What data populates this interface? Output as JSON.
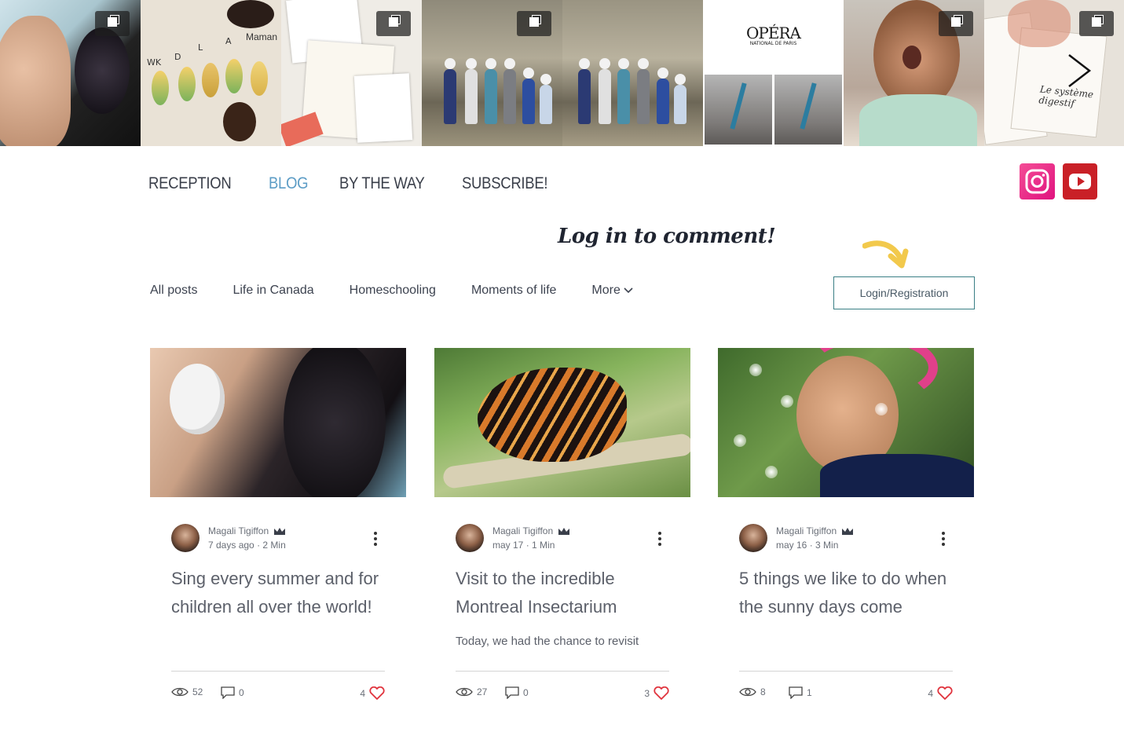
{
  "gallery": {
    "tile3_text": "Maman",
    "tile3_letters": [
      "WK",
      "D",
      "L",
      "A"
    ],
    "tile6_logo": "OPÉRA",
    "tile6_sub": "NATIONAL DE PARIS",
    "tile8_text": "Le système digestif"
  },
  "nav": {
    "items": [
      {
        "label": "RECEPTION"
      },
      {
        "label": "BLOG",
        "active": true
      },
      {
        "label": "BY THE WAY"
      },
      {
        "label": "SUBSCRIBE!"
      }
    ]
  },
  "social": {
    "icons": [
      "instagram-icon",
      "youtube-icon"
    ]
  },
  "cta": {
    "text": "Log in to comment!",
    "button": "Login/Registration"
  },
  "categories": {
    "items": [
      "All posts",
      "Life in Canada",
      "Homeschooling",
      "Moments of life"
    ],
    "more": "More"
  },
  "posts": [
    {
      "author": "Magali Tigiffon",
      "date": "7 days ago",
      "read": "2 Min",
      "title": "Sing every summer and for children all over the world!",
      "excerpt": "",
      "views": "52",
      "comments": "0",
      "likes": "4"
    },
    {
      "author": "Magali Tigiffon",
      "date": "may 17",
      "read": "1 Min",
      "title": "Visit to the incredible Montreal Insectarium",
      "excerpt": "Today, we had the chance to revisit",
      "views": "27",
      "comments": "0",
      "likes": "3"
    },
    {
      "author": "Magali Tigiffon",
      "date": "may 16",
      "read": "3 Min",
      "title": "5 things we like to do when the sunny days come",
      "excerpt": "",
      "views": "8",
      "comments": "1",
      "likes": "4"
    }
  ],
  "colors": {
    "accent": "#5d9dc6",
    "heart": "#e0323c",
    "button_border": "#3a7f85",
    "cta_arrow": "#f2c94c"
  }
}
